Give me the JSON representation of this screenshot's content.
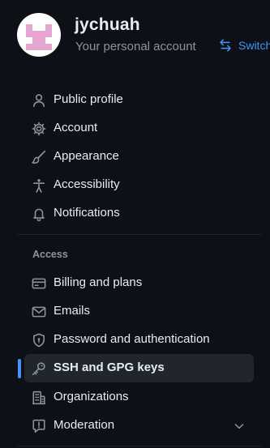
{
  "account": {
    "username": "jychuah",
    "subtitle": "Your personal account",
    "switch_label": "Switch",
    "avatar_icon": "identicon-avatar"
  },
  "nav": {
    "items": [
      {
        "label": "Public profile",
        "icon": "person-icon"
      },
      {
        "label": "Account",
        "icon": "gear-icon"
      },
      {
        "label": "Appearance",
        "icon": "paintbrush-icon"
      },
      {
        "label": "Accessibility",
        "icon": "accessibility-icon"
      },
      {
        "label": "Notifications",
        "icon": "bell-icon"
      }
    ],
    "access_heading": "Access",
    "access_items": [
      {
        "label": "Billing and plans",
        "icon": "credit-card-icon"
      },
      {
        "label": "Emails",
        "icon": "mail-icon"
      },
      {
        "label": "Password and authentication",
        "icon": "shield-lock-icon"
      },
      {
        "label": "SSH and GPG keys",
        "icon": "key-icon",
        "selected": true
      },
      {
        "label": "Organizations",
        "icon": "organization-icon"
      },
      {
        "label": "Moderation",
        "icon": "report-icon",
        "expandable": true
      }
    ]
  },
  "colors": {
    "background": "#0d1117",
    "text": "#e6edf3",
    "muted": "#8b949e",
    "accent": "#4493f8",
    "selected_bg": "#21262d"
  }
}
